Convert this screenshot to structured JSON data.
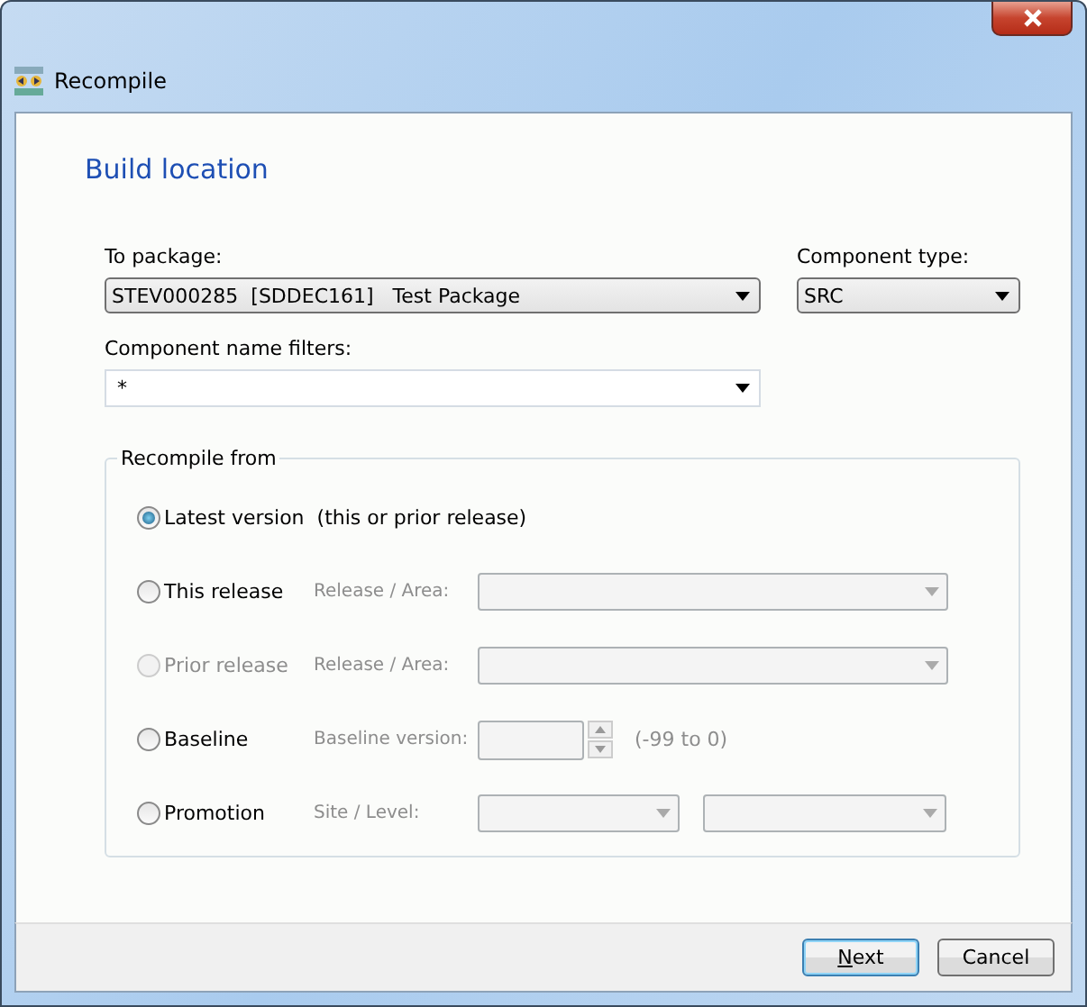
{
  "window": {
    "title": "Recompile"
  },
  "heading": "Build location",
  "to_package": {
    "label": "To package:",
    "value": "STEV000285  [SDDEC161]   Test Package"
  },
  "component_type": {
    "label": "Component type:",
    "value": "SRC"
  },
  "name_filters": {
    "label": "Component name filters:",
    "value": "*"
  },
  "recompile_from": {
    "title": "Recompile from",
    "options": [
      {
        "kind": "plain",
        "label": "Latest version  (this or prior release)",
        "selected": true,
        "disabled": false
      },
      {
        "kind": "combo",
        "label": "This release",
        "selected": false,
        "disabled": false,
        "field_label": "Release / Area:"
      },
      {
        "kind": "combo",
        "label": "Prior release",
        "selected": false,
        "disabled": true,
        "field_label": "Release / Area:"
      },
      {
        "kind": "spin",
        "label": "Baseline",
        "selected": false,
        "disabled": false,
        "field_label": "Baseline version:",
        "hint": "(-99 to 0)"
      },
      {
        "kind": "double_combo",
        "label": "Promotion",
        "selected": false,
        "disabled": false,
        "field_label": "Site / Level:"
      }
    ]
  },
  "buttons": [
    {
      "label": "Next",
      "first_letter_underlined": true,
      "default": true
    },
    {
      "label": "Cancel",
      "first_letter_underlined": false,
      "default": false
    }
  ]
}
